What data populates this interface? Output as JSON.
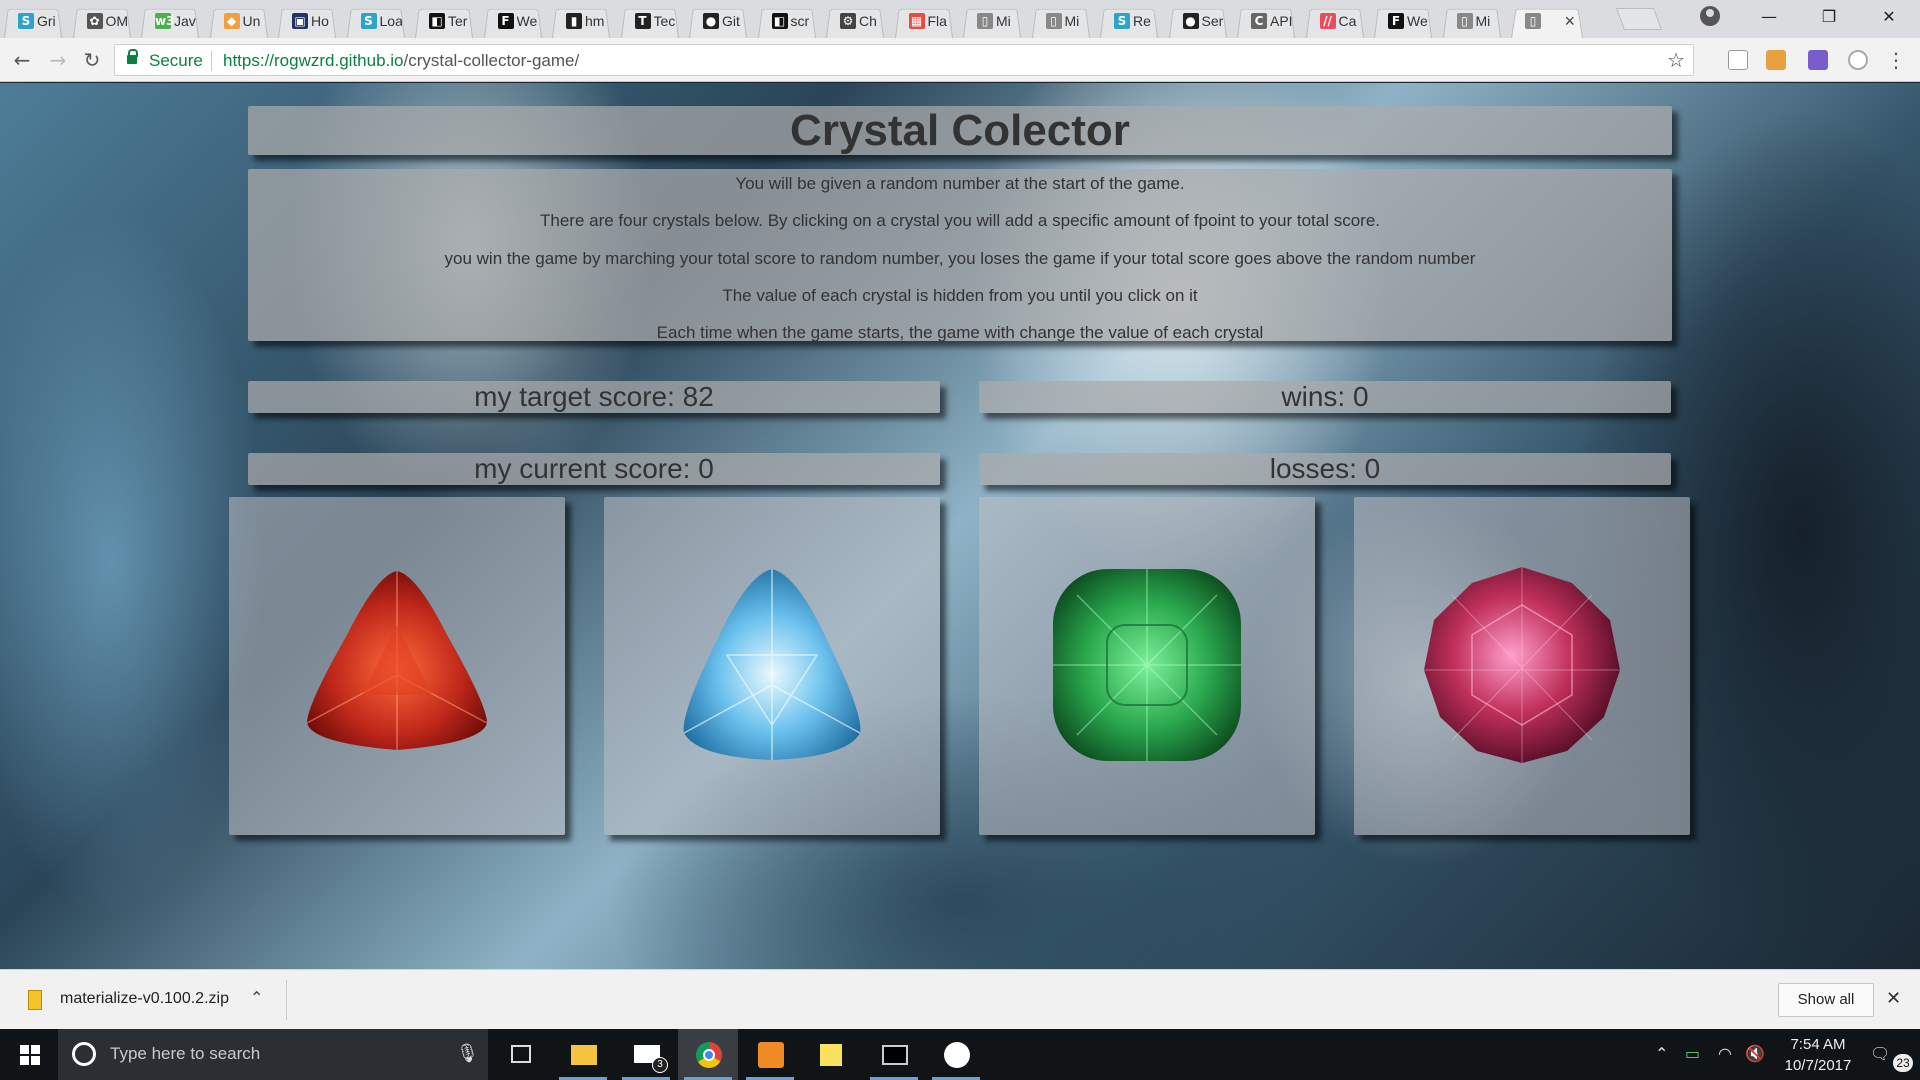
{
  "browser": {
    "tabs": [
      {
        "title": "Gri",
        "favicon": "S",
        "color": "#2fa3c9"
      },
      {
        "title": "OM",
        "favicon": "✿",
        "color": "#555555"
      },
      {
        "title": "Jav",
        "favicon": "w3",
        "color": "#4caf50"
      },
      {
        "title": "Un",
        "favicon": "◆",
        "color": "#f0a040"
      },
      {
        "title": "Ho",
        "favicon": "▣",
        "color": "#223366"
      },
      {
        "title": "Loa",
        "favicon": "S",
        "color": "#2fa3c9"
      },
      {
        "title": "Ter",
        "favicon": "◧",
        "color": "#111111"
      },
      {
        "title": "We",
        "favicon": "F",
        "color": "#111111"
      },
      {
        "title": "hm",
        "favicon": "▮",
        "color": "#222222"
      },
      {
        "title": "Tec",
        "favicon": "T",
        "color": "#222222"
      },
      {
        "title": "Git",
        "favicon": "●",
        "color": "#222222"
      },
      {
        "title": "scr",
        "favicon": "◧",
        "color": "#111111"
      },
      {
        "title": "Ch",
        "favicon": "⚙",
        "color": "#444444"
      },
      {
        "title": "Fla",
        "favicon": "▦",
        "color": "#e84c3d"
      },
      {
        "title": "Mi",
        "favicon": "▯",
        "color": "#888888"
      },
      {
        "title": "Mi",
        "favicon": "▯",
        "color": "#888888"
      },
      {
        "title": "Re",
        "favicon": "S",
        "color": "#2fa3c9"
      },
      {
        "title": "Ser",
        "favicon": "●",
        "color": "#222222"
      },
      {
        "title": "API",
        "favicon": "C",
        "color": "#666666"
      },
      {
        "title": "Ca",
        "favicon": "//",
        "color": "#e84c5d"
      },
      {
        "title": "We",
        "favicon": "F",
        "color": "#111111"
      },
      {
        "title": "Mi",
        "favicon": "▯",
        "color": "#888888"
      },
      {
        "title": "",
        "favicon": "▯",
        "color": "#888888"
      }
    ],
    "secure_label": "Secure",
    "url_host": "https://rogwzrd.github.io",
    "url_path": "/crystal-collector-game/",
    "minimize_glyph": "—",
    "restore_glyph": "❐",
    "close_glyph": "✕"
  },
  "game": {
    "title": "Crystal Colector",
    "rules": [
      "You will be given a random number at the start of the game.",
      "There are four crystals below. By clicking on a crystal you will add a specific amount of fpoint to your total score.",
      "you win the game by marching your total score to random number, you loses the game if your total score goes above the random number",
      "The value of each crystal is hidden from you until you click on it",
      "Each time when the game starts, the game with change the value of each crystal"
    ],
    "target_label": "my target score: 82",
    "current_label": "my current score: 0",
    "wins_label": "wins: 0",
    "losses_label": "losses: 0",
    "crystals": [
      {
        "name": "red-trillion-crystal",
        "color": "#c0281a"
      },
      {
        "name": "blue-trillion-crystal",
        "color": "#6cc2ee"
      },
      {
        "name": "green-cushion-crystal",
        "color": "#2aa84e"
      },
      {
        "name": "pink-round-crystal",
        "color": "#c0305a"
      }
    ]
  },
  "download_bar": {
    "file_name": "materialize-v0.100.2.zip",
    "show_all_label": "Show all"
  },
  "taskbar": {
    "search_placeholder": "Type here to search",
    "mail_badge": "3",
    "time": "7:54 AM",
    "date": "10/7/2017",
    "notification_count": "23"
  }
}
